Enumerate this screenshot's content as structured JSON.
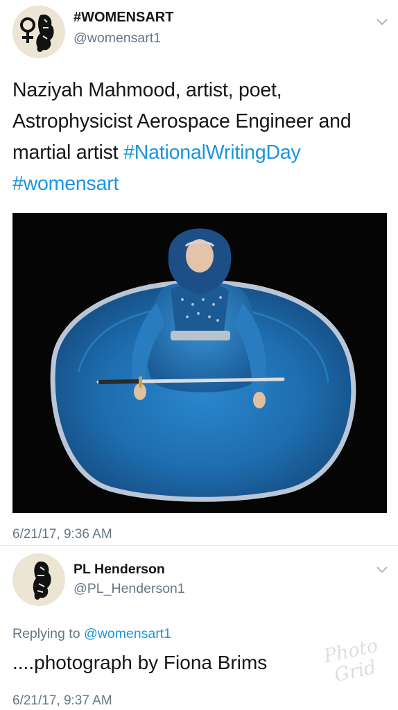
{
  "tweet": {
    "author_name": "#WOMENSART",
    "author_handle": "@womensart1",
    "text_plain": "Naziyah Mahmood, artist, poet, Astrophysicist Aerospace Engineer and martial artist ",
    "hashtags": [
      "#NationalWritingDay",
      "#womensart"
    ],
    "timestamp": "6/21/17, 9:36 AM",
    "menu_icon": "chevron-down-icon",
    "avatar_icon": "womens-symbol-logo-icon"
  },
  "reply": {
    "author_name": "PL Henderson",
    "author_handle": "@PL_Henderson1",
    "replying_prefix": "Replying to ",
    "replying_to": "@womensart1",
    "text": "....photograph by Fiona Brims",
    "timestamp": "6/21/17, 9:37 AM",
    "menu_icon": "chevron-down-icon",
    "avatar_icon": "feather-logo-icon"
  },
  "watermark": {
    "line1": "Photo",
    "line2": "Grid"
  },
  "colors": {
    "link": "#1b95e0",
    "secondary_text": "#657786",
    "primary_text": "#14171a",
    "dress": "#1f73b8"
  }
}
